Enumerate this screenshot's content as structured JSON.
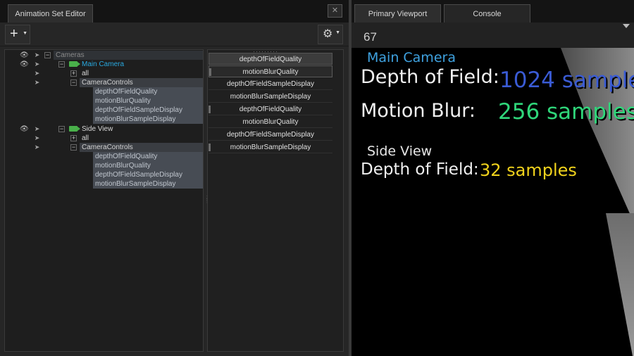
{
  "left_panel": {
    "tab_title": "Animation Set Editor",
    "close_glyph": "✕",
    "add_glyph": "+",
    "settings_glyph": "⚙",
    "tree": {
      "root": "Cameras",
      "cameras": [
        {
          "name": "Main Camera",
          "all_label": "all",
          "group": "CameraControls",
          "props": [
            "depthOfFieldQuality",
            "motionBlurQuality",
            "depthOfFieldSampleDisplay",
            "motionBlurSampleDisplay"
          ]
        },
        {
          "name": "Side View",
          "all_label": "all",
          "group": "CameraControls",
          "props": [
            "depthOfFieldQuality",
            "motionBlurQuality",
            "depthOfFieldSampleDisplay",
            "motionBlurSampleDisplay"
          ]
        }
      ]
    },
    "sequence": [
      "depthOfFieldQuality",
      "motionBlurQuality",
      "depthOfFieldSampleDisplay",
      "motionBlurSampleDisplay",
      "depthOfFieldQuality",
      "motionBlurQuality",
      "depthOfFieldSampleDisplay",
      "motionBlurSampleDisplay"
    ]
  },
  "right_panel": {
    "tabs": [
      "Primary Viewport",
      "Console"
    ],
    "fps": "67",
    "overlay": {
      "main_camera_title": "Main Camera",
      "dof_label": "Depth of Field:",
      "dof_value": "1024 samples",
      "mb_label": "Motion Blur:",
      "mb_value": "256 samples",
      "side_view_title": "Side View",
      "side_dof_label": "Depth of Field:",
      "side_dof_value": "32 samples"
    },
    "colors": {
      "main_title": "#3fa2e0",
      "dof_value": "#3a5bd4",
      "mb_value": "#2fd67a",
      "side_dof_value": "#f0d21c"
    }
  }
}
